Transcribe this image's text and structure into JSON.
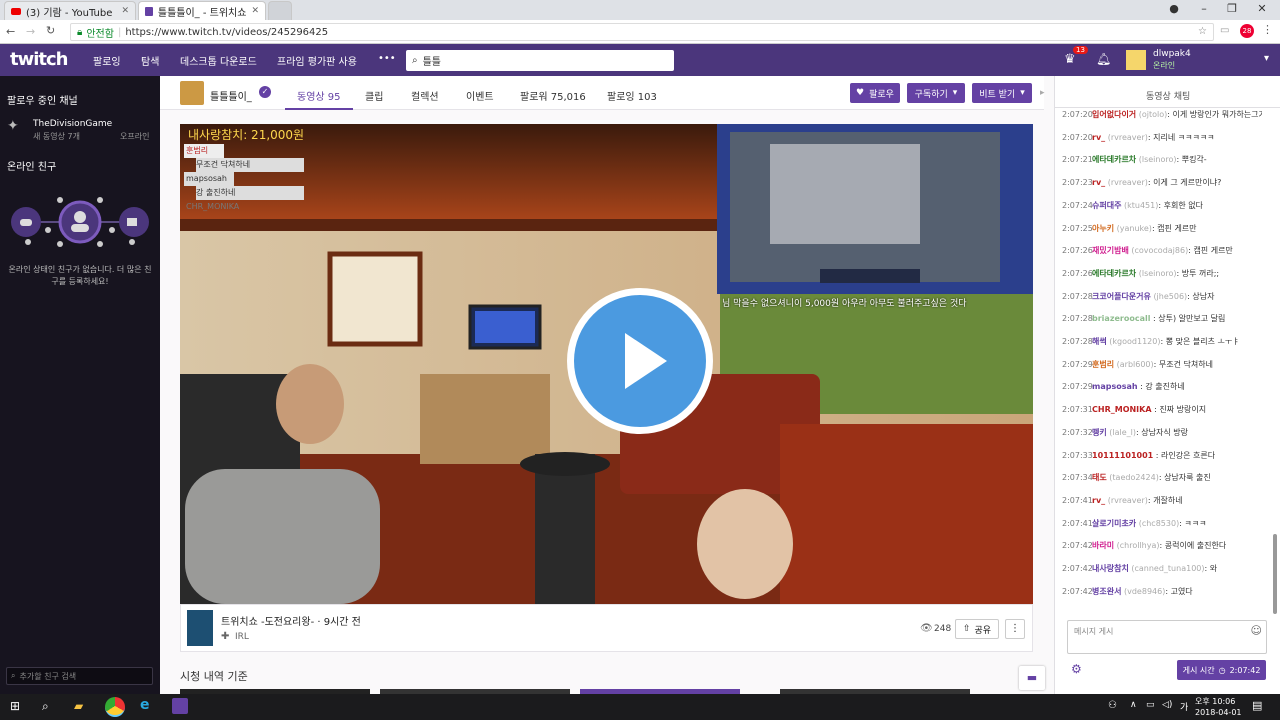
{
  "browser": {
    "tabs": [
      {
        "label": "(3) 기람 - YouTube"
      },
      {
        "label": "틀틀틀이_ - 트위치쇼"
      },
      {
        "label": ""
      }
    ],
    "secure_label": "안전함",
    "url": "https://www.twitch.tv/videos/245296425",
    "ext_badge": "28"
  },
  "nav": {
    "logo": "twitch",
    "links": [
      "팔로잉",
      "탐색",
      "데스크톱 다운로드",
      "프라임 평가판 사용",
      "•••"
    ],
    "search_value": "틀틀",
    "crown_badge": "13",
    "username": "dlwpak4",
    "status": "온라인"
  },
  "sidebar": {
    "following_header": "팔로우 중인 채널",
    "channel_name": "TheDivisionGame",
    "channel_sub": "새 동영상 7개",
    "channel_status": "오프라인",
    "friends_header": "온라인 친구",
    "empty_text": "온라인 상태인 친구가 없습니다. 더 많은 친구를 등록하세요!",
    "search_placeholder": "추가할 친구 검색"
  },
  "channel": {
    "name": "틀틀틀이_",
    "tabs": [
      "동영상 95",
      "클립",
      "컬렉션",
      "이벤트",
      "팔로워 75,016",
      "팔로잉 103"
    ],
    "follow_btn": "팔로우",
    "sub_btn": "구독하기",
    "bits_btn": "비트 받기"
  },
  "video": {
    "overlay_top": "내사랑참치: 21,000원",
    "donor_rows": [
      "훈범리",
      "무조건 닥쳐하네",
      "mapsosah",
      "강 출진하네",
      "CHR_MONIKA"
    ],
    "cam_caption": "님 막을수 없으셔니이 5,000원 아우라 아무도 불러주고싶은 것다",
    "title": "트위치쇼 -도전요리왕- · 9시간 전",
    "category": "IRL",
    "views": "248",
    "share": "공유",
    "more": "⋮"
  },
  "below_video": {
    "label": "시청 내역 기준"
  },
  "chat": {
    "header": "동영상 채팅",
    "messages": [
      {
        "t": "2:07:20",
        "u": "입어없다이거",
        "id": "(ojtolo)",
        "m": ": 이게 방랑인가 뭐가하는그거냐",
        "c": "#b22"
      },
      {
        "t": "2:07:20",
        "u": "rv_",
        "id": "(rvreaver)",
        "m": ": 지리네 ㅋㅋㅋㅋㅋ",
        "c": "#b22"
      },
      {
        "t": "2:07:21",
        "u": "에타데카르차",
        "id": "(lseinoro)",
        "m": ": 뿌킹각-",
        "c": "#2a7a2a"
      },
      {
        "t": "2:07:23",
        "u": "rv_",
        "id": "(rvreaver)",
        "m": ": 이게 그 게르만이냐?",
        "c": "#b22"
      },
      {
        "t": "2:07:24",
        "u": "슈퍼대주",
        "id": "(ktu451)",
        "m": ": 후회한 없다",
        "c": "#6441a4"
      },
      {
        "t": "2:07:25",
        "u": "아누키",
        "id": "(yanuke)",
        "m": ": 캡핀 게르만",
        "c": "#d2691e"
      },
      {
        "t": "2:07:26",
        "u": "재밌기밤배",
        "id": "(covocodaj86)",
        "m": ": 캡핀 게르만",
        "c": "#d02090"
      },
      {
        "t": "2:07:26",
        "u": "에타데카르차",
        "id": "(lseinoro)",
        "m": ": 방투 꺼라;;",
        "c": "#2a7a2a"
      },
      {
        "t": "2:07:28",
        "u": "크코어플다운거유",
        "id": "(jhe506)",
        "m": ": 상남자",
        "c": "#6441a4"
      },
      {
        "t": "2:07:28",
        "u": "briazeroocall",
        "id": "",
        "m": ": 상투) 알만보고 달림",
        "c": "#8fbc8f"
      },
      {
        "t": "2:07:28",
        "u": "해썩",
        "id": "(kgood1120)",
        "m": ": 뽕 맞은 블리츠 ㅗㅜㅑ",
        "c": "#6441a4"
      },
      {
        "t": "2:07:29",
        "u": "훈범리",
        "id": "(arbl600)",
        "m": ": 무조건 닥쳐하네",
        "c": "#d2691e"
      },
      {
        "t": "2:07:29",
        "u": "mapsosah",
        "id": "",
        "m": ": 강 출진하네",
        "c": "#6441a4"
      },
      {
        "t": "2:07:31",
        "u": "CHR_MONIKA",
        "id": "",
        "m": ": 진짜 방랑이지",
        "c": "#b22"
      },
      {
        "t": "2:07:32",
        "u": "뗑키",
        "id": "(lale_l)",
        "m": ": 상남자식 방랑",
        "c": "#6441a4"
      },
      {
        "t": "2:07:33",
        "u": "10111101001",
        "id": "",
        "m": ": 라인강은 흐른다",
        "c": "#b22"
      },
      {
        "t": "2:07:34",
        "u": "태도",
        "id": "(taedo2424)",
        "m": ": 상남자룩 출진",
        "c": "#b22"
      },
      {
        "t": "2:07:41",
        "u": "rv_",
        "id": "(rvreaver)",
        "m": ": 개잘하네",
        "c": "#b22"
      },
      {
        "t": "2:07:41",
        "u": "살로기미초카",
        "id": "(chc8530)",
        "m": ": ㅋㅋㅋ",
        "c": "#6441a4"
      },
      {
        "t": "2:07:42",
        "u": "바라미",
        "id": "(chrollhya)",
        "m": ": 콩럭이에 출진한다",
        "c": "#d02090"
      },
      {
        "t": "2:07:42",
        "u": "내사랑참치",
        "id": "(canned_tuna100)",
        "m": ": 와",
        "c": "#6441a4"
      },
      {
        "t": "2:07:42",
        "u": "병조완서",
        "id": "(vde8946)",
        "m": ": 고였다",
        "c": "#6441a4"
      }
    ],
    "input_placeholder": "메시지 게시",
    "time_btn": "게시 시간",
    "time_value": "2:07:42"
  },
  "taskbar": {
    "time": "오후 10:06",
    "date": "2018-04-01"
  }
}
